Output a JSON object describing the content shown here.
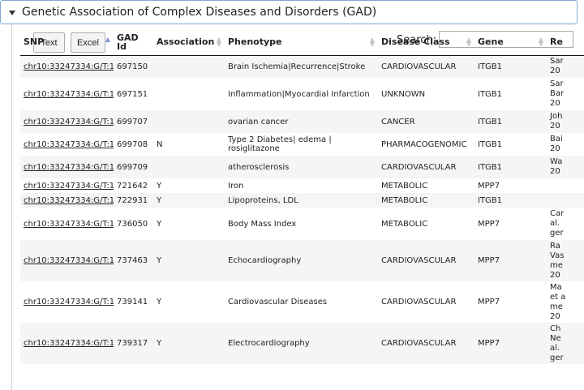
{
  "panel": {
    "title": "Genetic Association of Complex Diseases and Disorders (GAD)"
  },
  "toolbar": {
    "text_label": "Text",
    "excel_label": "Excel",
    "search_label": "Search:",
    "search_value": ""
  },
  "table": {
    "columns": [
      "SNP",
      "GAD Id",
      "Association",
      "Phenotype",
      "Disease Class",
      "Gene",
      "Re"
    ],
    "sorted_column": "GAD Id",
    "rows": [
      {
        "snp": "chr10:33247334:G/T:1",
        "gad_id": "697150",
        "association": "",
        "phenotype": "Brain Ischemia|Recurrence|Stroke",
        "disease_class": "CARDIOVASCULAR",
        "gene": "ITGB1",
        "ref": "Sar\n20"
      },
      {
        "snp": "chr10:33247334:G/T:1",
        "gad_id": "697151",
        "association": "",
        "phenotype": "Inflammation|Myocardial Infarction",
        "disease_class": "UNKNOWN",
        "gene": "ITGB1",
        "ref": "Sar\nBar\n20"
      },
      {
        "snp": "chr10:33247334:G/T:1",
        "gad_id": "699707",
        "association": "",
        "phenotype": "ovarian cancer",
        "disease_class": "CANCER",
        "gene": "ITGB1",
        "ref": "Joh\n20"
      },
      {
        "snp": "chr10:33247334:G/T:1",
        "gad_id": "699708",
        "association": "N",
        "phenotype": "Type 2 Diabetes| edema | rosiglitazone",
        "disease_class": "PHARMACOGENOMIC",
        "gene": "ITGB1",
        "ref": "Bai\n20"
      },
      {
        "snp": "chr10:33247334:G/T:1",
        "gad_id": "699709",
        "association": "",
        "phenotype": "atherosclerosis",
        "disease_class": "CARDIOVASCULAR",
        "gene": "ITGB1",
        "ref": "Wa\n20"
      },
      {
        "snp": "chr10:33247334:G/T:1",
        "gad_id": "721642",
        "association": "Y",
        "phenotype": "Iron",
        "disease_class": "METABOLIC",
        "gene": "MPP7",
        "ref": ""
      },
      {
        "snp": "chr10:33247334:G/T:1",
        "gad_id": "722931",
        "association": "Y",
        "phenotype": "Lipoproteins, LDL",
        "disease_class": "METABOLIC",
        "gene": "ITGB1",
        "ref": ""
      },
      {
        "snp": "chr10:33247334:G/T:1",
        "gad_id": "736050",
        "association": "Y",
        "phenotype": "Body Mass Index",
        "disease_class": "METABOLIC",
        "gene": "MPP7",
        "ref": "Car\nal.\nger"
      },
      {
        "snp": "chr10:33247334:G/T:1",
        "gad_id": "737463",
        "association": "Y",
        "phenotype": "Echocardiography",
        "disease_class": "CARDIOVASCULAR",
        "gene": "MPP7",
        "ref": "Ra\nVas\nme\n20"
      },
      {
        "snp": "chr10:33247334:G/T:1",
        "gad_id": "739141",
        "association": "Y",
        "phenotype": "Cardiovascular Diseases",
        "disease_class": "CARDIOVASCULAR",
        "gene": "MPP7",
        "ref": "Ma\net a\nme\n20"
      },
      {
        "snp": "chr10:33247334:G/T:1",
        "gad_id": "739317",
        "association": "Y",
        "phenotype": "Electrocardiography",
        "disease_class": "CARDIOVASCULAR",
        "gene": "MPP7",
        "ref": "Ch\nNe\nal.\nger"
      }
    ]
  }
}
